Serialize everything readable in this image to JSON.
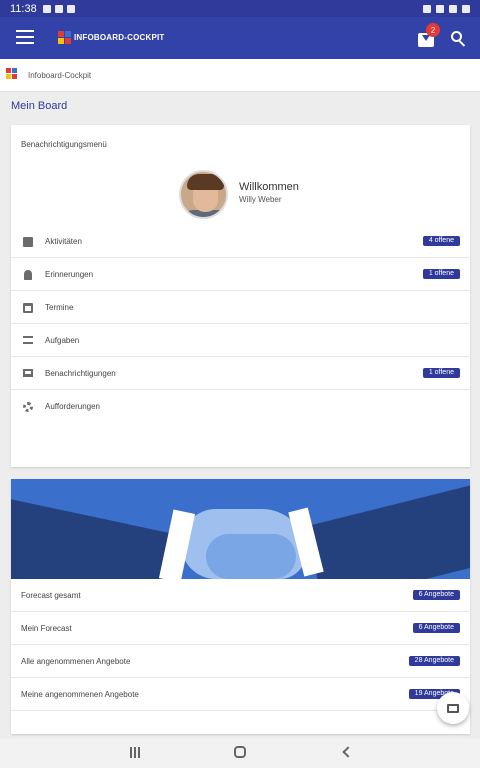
{
  "status_bar": {
    "time": "11:38"
  },
  "app_bar": {
    "brand": "INFOBOARD-COCKPIT",
    "inbox_count": "2"
  },
  "breadcrumb": {
    "label": "Infoboard-Cockpit"
  },
  "page": {
    "title": "Mein Board"
  },
  "notification_card": {
    "title": "Benachrichtigungsmenü",
    "welcome": {
      "heading": "Willkommen",
      "name": "Willy Weber"
    },
    "items": [
      {
        "label": "Aktivitäten",
        "badge": "4 offene",
        "icon": "task-check-icon"
      },
      {
        "label": "Erinnerungen",
        "badge": "1 offene",
        "icon": "bell-icon"
      },
      {
        "label": "Termine",
        "badge": "",
        "icon": "calendar-icon"
      },
      {
        "label": "Aufgaben",
        "badge": "",
        "icon": "checklist-icon"
      },
      {
        "label": "Benachrichtigungen",
        "badge": "1 offene",
        "icon": "laptop-icon"
      },
      {
        "label": "Aufforderungen",
        "badge": "",
        "icon": "gears-icon"
      }
    ]
  },
  "forecast_card": {
    "items": [
      {
        "label": "Forecast gesamt",
        "badge": "6 Angebote"
      },
      {
        "label": "Mein Forecast",
        "badge": "6 Angebote"
      },
      {
        "label": "Alle angenommenen Angebote",
        "badge": "28 Angebote"
      },
      {
        "label": "Meine angenommenen Angebote",
        "badge": "19 Angebote"
      }
    ]
  },
  "colors": {
    "primary": "#3342a8",
    "badge": "#2f3a9a",
    "notification": "#e53935"
  }
}
